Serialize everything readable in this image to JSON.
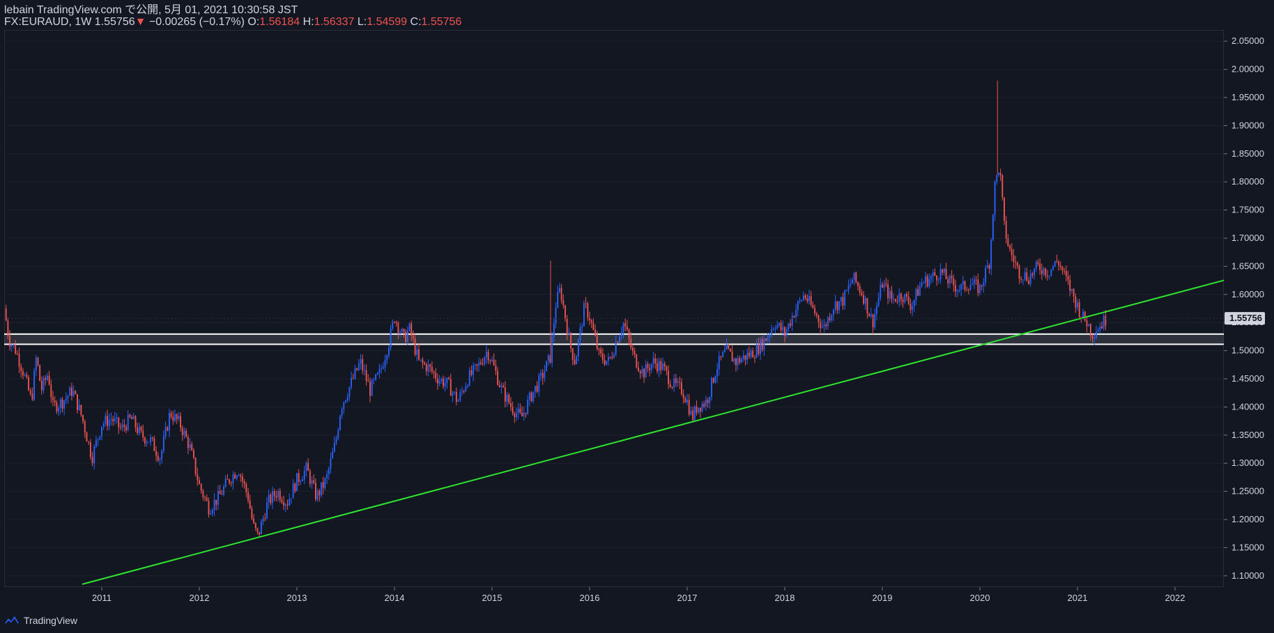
{
  "header": {
    "line1": "lebain TradingView.com で公開, 5月 01, 2021 10:30:58 JST",
    "symbol": "FX:EURAUD, 1W",
    "last": "1.55756",
    "change_arrow": "▼",
    "change": "−0.00265 (−0.17%)",
    "o_label": "O:",
    "o_value": "1.56184",
    "h_label": "H:",
    "h_value": "1.56337",
    "l_label": "L:",
    "l_value": "1.54599",
    "c_label": "C:",
    "c_value": "1.55756"
  },
  "footer": {
    "brand": "TradingView",
    "logo_icon": "tradingview-logo-icon"
  },
  "colors": {
    "background": "#131722",
    "up": "#2962ff",
    "down": "#ef5350",
    "trendline": "#2ee62e",
    "level_line": "#ffffff",
    "price_label_bg": "#d1d4dc"
  },
  "chart_data": {
    "type": "candlestick",
    "symbol": "FX:EURAUD",
    "timeframe": "1W",
    "x_ticks": [
      "2011",
      "2012",
      "2013",
      "2014",
      "2015",
      "2016",
      "2017",
      "2018",
      "2019",
      "2020",
      "2021",
      "2022"
    ],
    "x_range": [
      2010.0,
      2022.5
    ],
    "y_ticks": [
      "1.10000",
      "1.15000",
      "1.20000",
      "1.25000",
      "1.30000",
      "1.35000",
      "1.40000",
      "1.45000",
      "1.50000",
      "1.55000",
      "1.60000",
      "1.65000",
      "1.70000",
      "1.75000",
      "1.80000",
      "1.85000",
      "1.90000",
      "1.95000",
      "2.00000",
      "2.05000"
    ],
    "y_range": [
      1.08,
      2.07
    ],
    "last_price_label": "1.55756",
    "closes": [
      {
        "t": 2010.0,
        "c": 1.575
      },
      {
        "t": 2010.05,
        "c": 1.52
      },
      {
        "t": 2010.12,
        "c": 1.5
      },
      {
        "t": 2010.2,
        "c": 1.46
      },
      {
        "t": 2010.28,
        "c": 1.41
      },
      {
        "t": 2010.33,
        "c": 1.49
      },
      {
        "t": 2010.38,
        "c": 1.43
      },
      {
        "t": 2010.45,
        "c": 1.46
      },
      {
        "t": 2010.5,
        "c": 1.4
      },
      {
        "t": 2010.6,
        "c": 1.41
      },
      {
        "t": 2010.7,
        "c": 1.43
      },
      {
        "t": 2010.8,
        "c": 1.38
      },
      {
        "t": 2010.9,
        "c": 1.31
      },
      {
        "t": 2011.0,
        "c": 1.37
      },
      {
        "t": 2011.1,
        "c": 1.38
      },
      {
        "t": 2011.2,
        "c": 1.36
      },
      {
        "t": 2011.3,
        "c": 1.38
      },
      {
        "t": 2011.4,
        "c": 1.35
      },
      {
        "t": 2011.5,
        "c": 1.34
      },
      {
        "t": 2011.6,
        "c": 1.31
      },
      {
        "t": 2011.7,
        "c": 1.39
      },
      {
        "t": 2011.8,
        "c": 1.37
      },
      {
        "t": 2011.9,
        "c": 1.33
      },
      {
        "t": 2012.0,
        "c": 1.26
      },
      {
        "t": 2012.1,
        "c": 1.22
      },
      {
        "t": 2012.2,
        "c": 1.24
      },
      {
        "t": 2012.3,
        "c": 1.27
      },
      {
        "t": 2012.4,
        "c": 1.29
      },
      {
        "t": 2012.5,
        "c": 1.24
      },
      {
        "t": 2012.55,
        "c": 1.19
      },
      {
        "t": 2012.6,
        "c": 1.17
      },
      {
        "t": 2012.7,
        "c": 1.23
      },
      {
        "t": 2012.8,
        "c": 1.25
      },
      {
        "t": 2012.9,
        "c": 1.23
      },
      {
        "t": 2013.0,
        "c": 1.27
      },
      {
        "t": 2013.1,
        "c": 1.29
      },
      {
        "t": 2013.2,
        "c": 1.24
      },
      {
        "t": 2013.3,
        "c": 1.27
      },
      {
        "t": 2013.4,
        "c": 1.34
      },
      {
        "t": 2013.45,
        "c": 1.4
      },
      {
        "t": 2013.55,
        "c": 1.44
      },
      {
        "t": 2013.65,
        "c": 1.48
      },
      {
        "t": 2013.75,
        "c": 1.43
      },
      {
        "t": 2013.85,
        "c": 1.46
      },
      {
        "t": 2013.95,
        "c": 1.52
      },
      {
        "t": 2014.0,
        "c": 1.56
      },
      {
        "t": 2014.1,
        "c": 1.52
      },
      {
        "t": 2014.15,
        "c": 1.54
      },
      {
        "t": 2014.25,
        "c": 1.48
      },
      {
        "t": 2014.35,
        "c": 1.47
      },
      {
        "t": 2014.45,
        "c": 1.45
      },
      {
        "t": 2014.55,
        "c": 1.44
      },
      {
        "t": 2014.65,
        "c": 1.41
      },
      {
        "t": 2014.75,
        "c": 1.45
      },
      {
        "t": 2014.85,
        "c": 1.47
      },
      {
        "t": 2014.95,
        "c": 1.5
      },
      {
        "t": 2015.0,
        "c": 1.48
      },
      {
        "t": 2015.1,
        "c": 1.43
      },
      {
        "t": 2015.2,
        "c": 1.4
      },
      {
        "t": 2015.3,
        "c": 1.38
      },
      {
        "t": 2015.4,
        "c": 1.42
      },
      {
        "t": 2015.5,
        "c": 1.45
      },
      {
        "t": 2015.6,
        "c": 1.49
      },
      {
        "t": 2015.65,
        "c": 1.58
      },
      {
        "t": 2015.7,
        "c": 1.61
      },
      {
        "t": 2015.8,
        "c": 1.51
      },
      {
        "t": 2015.85,
        "c": 1.48
      },
      {
        "t": 2015.95,
        "c": 1.58
      },
      {
        "t": 2016.0,
        "c": 1.56
      },
      {
        "t": 2016.1,
        "c": 1.49
      },
      {
        "t": 2016.2,
        "c": 1.48
      },
      {
        "t": 2016.3,
        "c": 1.53
      },
      {
        "t": 2016.35,
        "c": 1.55
      },
      {
        "t": 2016.45,
        "c": 1.49
      },
      {
        "t": 2016.55,
        "c": 1.46
      },
      {
        "t": 2016.65,
        "c": 1.48
      },
      {
        "t": 2016.75,
        "c": 1.47
      },
      {
        "t": 2016.85,
        "c": 1.44
      },
      {
        "t": 2016.95,
        "c": 1.43
      },
      {
        "t": 2017.0,
        "c": 1.41
      },
      {
        "t": 2017.05,
        "c": 1.38
      },
      {
        "t": 2017.1,
        "c": 1.4
      },
      {
        "t": 2017.2,
        "c": 1.41
      },
      {
        "t": 2017.3,
        "c": 1.47
      },
      {
        "t": 2017.4,
        "c": 1.5
      },
      {
        "t": 2017.5,
        "c": 1.48
      },
      {
        "t": 2017.6,
        "c": 1.49
      },
      {
        "t": 2017.7,
        "c": 1.5
      },
      {
        "t": 2017.8,
        "c": 1.52
      },
      {
        "t": 2017.9,
        "c": 1.55
      },
      {
        "t": 2018.0,
        "c": 1.53
      },
      {
        "t": 2018.1,
        "c": 1.57
      },
      {
        "t": 2018.2,
        "c": 1.6
      },
      {
        "t": 2018.3,
        "c": 1.57
      },
      {
        "t": 2018.4,
        "c": 1.54
      },
      {
        "t": 2018.5,
        "c": 1.58
      },
      {
        "t": 2018.6,
        "c": 1.59
      },
      {
        "t": 2018.7,
        "c": 1.63
      },
      {
        "t": 2018.8,
        "c": 1.6
      },
      {
        "t": 2018.9,
        "c": 1.55
      },
      {
        "t": 2019.0,
        "c": 1.62
      },
      {
        "t": 2019.1,
        "c": 1.59
      },
      {
        "t": 2019.2,
        "c": 1.6
      },
      {
        "t": 2019.3,
        "c": 1.58
      },
      {
        "t": 2019.4,
        "c": 1.62
      },
      {
        "t": 2019.5,
        "c": 1.63
      },
      {
        "t": 2019.6,
        "c": 1.64
      },
      {
        "t": 2019.7,
        "c": 1.62
      },
      {
        "t": 2019.8,
        "c": 1.61
      },
      {
        "t": 2019.9,
        "c": 1.62
      },
      {
        "t": 2020.0,
        "c": 1.61
      },
      {
        "t": 2020.1,
        "c": 1.66
      },
      {
        "t": 2020.15,
        "c": 1.79
      },
      {
        "t": 2020.2,
        "c": 1.83
      },
      {
        "t": 2020.25,
        "c": 1.72
      },
      {
        "t": 2020.3,
        "c": 1.68
      },
      {
        "t": 2020.4,
        "c": 1.64
      },
      {
        "t": 2020.5,
        "c": 1.63
      },
      {
        "t": 2020.6,
        "c": 1.65
      },
      {
        "t": 2020.7,
        "c": 1.64
      },
      {
        "t": 2020.8,
        "c": 1.66
      },
      {
        "t": 2020.9,
        "c": 1.62
      },
      {
        "t": 2021.0,
        "c": 1.58
      },
      {
        "t": 2021.05,
        "c": 1.56
      },
      {
        "t": 2021.1,
        "c": 1.55
      },
      {
        "t": 2021.15,
        "c": 1.53
      },
      {
        "t": 2021.2,
        "c": 1.54
      },
      {
        "t": 2021.25,
        "c": 1.548
      },
      {
        "t": 2021.3,
        "c": 1.5576
      }
    ],
    "spikes": [
      {
        "t": 2020.18,
        "high": 1.98
      },
      {
        "t": 2015.6,
        "high": 1.66
      }
    ],
    "horizontal_levels": [
      1.5295,
      1.5115
    ],
    "trendline": {
      "from": {
        "t": 2010.8,
        "y": 1.085
      },
      "to": {
        "t": 2022.5,
        "y": 1.625
      }
    }
  }
}
